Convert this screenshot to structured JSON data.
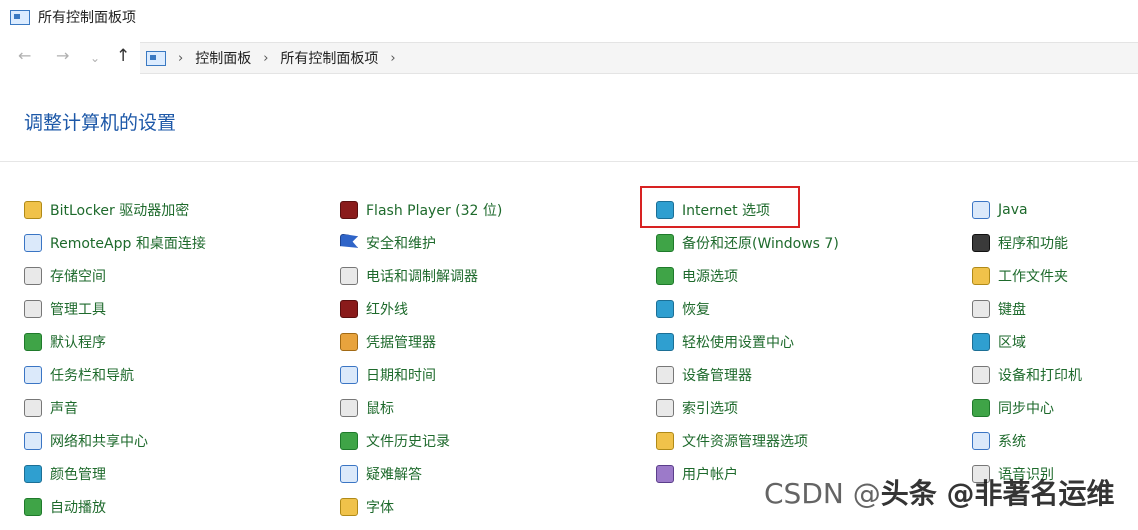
{
  "window": {
    "title": "所有控制面板项"
  },
  "nav": {
    "back_glyph": "←",
    "forward_glyph": "→",
    "recent_glyph": "⌄",
    "up_glyph": "↑",
    "breadcrumbs": [
      "控制面板",
      "所有控制面板项"
    ],
    "sep_glyph": "›"
  },
  "heading": "调整计算机的设置",
  "columns": [
    [
      {
        "label": "BitLocker 驱动器加密",
        "icon": "bitlocker-icon"
      },
      {
        "label": "RemoteApp 和桌面连接",
        "icon": "remoteapp-icon"
      },
      {
        "label": "存储空间",
        "icon": "storage-spaces-icon"
      },
      {
        "label": "管理工具",
        "icon": "admin-tools-icon"
      },
      {
        "label": "默认程序",
        "icon": "default-programs-icon"
      },
      {
        "label": "任务栏和导航",
        "icon": "taskbar-icon"
      },
      {
        "label": "声音",
        "icon": "sound-icon"
      },
      {
        "label": "网络和共享中心",
        "icon": "network-icon"
      },
      {
        "label": "颜色管理",
        "icon": "color-management-icon"
      },
      {
        "label": "自动播放",
        "icon": "autoplay-icon"
      }
    ],
    [
      {
        "label": "Flash Player (32 位)",
        "icon": "flash-player-icon"
      },
      {
        "label": "安全和维护",
        "icon": "security-flag-icon"
      },
      {
        "label": "电话和调制解调器",
        "icon": "phone-modem-icon"
      },
      {
        "label": "红外线",
        "icon": "infrared-icon"
      },
      {
        "label": "凭据管理器",
        "icon": "credential-manager-icon"
      },
      {
        "label": "日期和时间",
        "icon": "date-time-icon"
      },
      {
        "label": "鼠标",
        "icon": "mouse-icon"
      },
      {
        "label": "文件历史记录",
        "icon": "file-history-icon"
      },
      {
        "label": "疑难解答",
        "icon": "troubleshoot-icon"
      },
      {
        "label": "字体",
        "icon": "fonts-icon"
      }
    ],
    [
      {
        "label": "Internet 选项",
        "icon": "internet-options-icon"
      },
      {
        "label": "备份和还原(Windows 7)",
        "icon": "backup-restore-icon"
      },
      {
        "label": "电源选项",
        "icon": "power-options-icon"
      },
      {
        "label": "恢复",
        "icon": "recovery-icon"
      },
      {
        "label": "轻松使用设置中心",
        "icon": "ease-of-access-icon"
      },
      {
        "label": "设备管理器",
        "icon": "device-manager-icon"
      },
      {
        "label": "索引选项",
        "icon": "indexing-icon"
      },
      {
        "label": "文件资源管理器选项",
        "icon": "explorer-options-icon"
      },
      {
        "label": "用户帐户",
        "icon": "user-accounts-icon"
      }
    ],
    [
      {
        "label": "Java",
        "icon": "java-icon"
      },
      {
        "label": "程序和功能",
        "icon": "programs-features-icon"
      },
      {
        "label": "工作文件夹",
        "icon": "work-folders-icon"
      },
      {
        "label": "键盘",
        "icon": "keyboard-icon"
      },
      {
        "label": "区域",
        "icon": "region-icon"
      },
      {
        "label": "设备和打印机",
        "icon": "devices-printers-icon"
      },
      {
        "label": "同步中心",
        "icon": "sync-center-icon"
      },
      {
        "label": "系统",
        "icon": "system-icon"
      },
      {
        "label": "语音识别",
        "icon": "speech-recognition-icon"
      }
    ]
  ],
  "watermark": {
    "prefix": "CSDN @",
    "brand": "头条 @非著名运维"
  }
}
